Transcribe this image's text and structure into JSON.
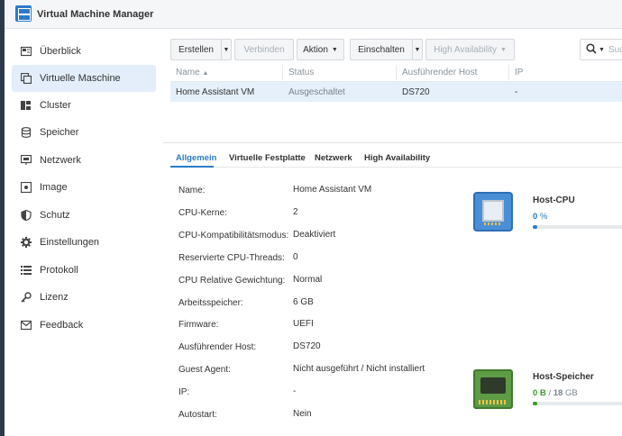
{
  "app": {
    "title": "Virtual Machine Manager"
  },
  "sidebar": {
    "items": [
      {
        "label": "Überblick",
        "icon": "overview-icon"
      },
      {
        "label": "Virtuelle Maschine",
        "icon": "virtual-machine-icon",
        "active": true
      },
      {
        "label": "Cluster",
        "icon": "cluster-icon"
      },
      {
        "label": "Speicher",
        "icon": "storage-icon"
      },
      {
        "label": "Netzwerk",
        "icon": "network-icon"
      },
      {
        "label": "Image",
        "icon": "image-icon"
      },
      {
        "label": "Schutz",
        "icon": "shield-icon"
      },
      {
        "label": "Einstellungen",
        "icon": "gear-icon"
      },
      {
        "label": "Protokoll",
        "icon": "log-icon"
      },
      {
        "label": "Lizenz",
        "icon": "key-icon"
      },
      {
        "label": "Feedback",
        "icon": "feedback-icon"
      }
    ]
  },
  "toolbar": {
    "create": "Erstellen",
    "connect": "Verbinden",
    "action": "Aktion",
    "power_on": "Einschalten",
    "high_availability": "High Availability",
    "search_placeholder": "Suche"
  },
  "grid": {
    "columns": [
      "Name",
      "Status",
      "Ausführender Host",
      "IP"
    ],
    "rows": [
      {
        "name": "Home Assistant VM",
        "status": "Ausgeschaltet",
        "host": "DS720",
        "ip": "-"
      }
    ]
  },
  "tabs": [
    "Allgemein",
    "Virtuelle Festplatte",
    "Netzwerk",
    "High Availability"
  ],
  "properties": [
    {
      "label": "Name:",
      "value": "Home Assistant VM"
    },
    {
      "label": "CPU-Kerne:",
      "value": "2"
    },
    {
      "label": "CPU-Kompatibilitätsmodus:",
      "value": "Deaktiviert"
    },
    {
      "label": "Reservierte CPU-Threads:",
      "value": "0"
    },
    {
      "label": "CPU Relative Gewichtung:",
      "value": "Normal"
    },
    {
      "label": "Arbeitsspeicher:",
      "value": "6 GB"
    },
    {
      "label": "Firmware:",
      "value": "UEFI"
    },
    {
      "label": "Ausführender Host:",
      "value": "DS720"
    },
    {
      "label": "Guest Agent:",
      "value": "Nicht ausgeführt / Nicht installiert"
    },
    {
      "label": "IP:",
      "value": "-"
    },
    {
      "label": "Autostart:",
      "value": "Nein"
    }
  ],
  "resources": {
    "cpu": {
      "title": "Host-CPU",
      "value": "0",
      "unit": "%",
      "color": "#2a7bc8",
      "level": 0
    },
    "memory": {
      "title": "Host-Speicher",
      "used": "0",
      "used_unit": "B",
      "separator": " / ",
      "total": "18",
      "total_unit": "GB",
      "color": "#3a9a2a",
      "level": 0
    }
  }
}
